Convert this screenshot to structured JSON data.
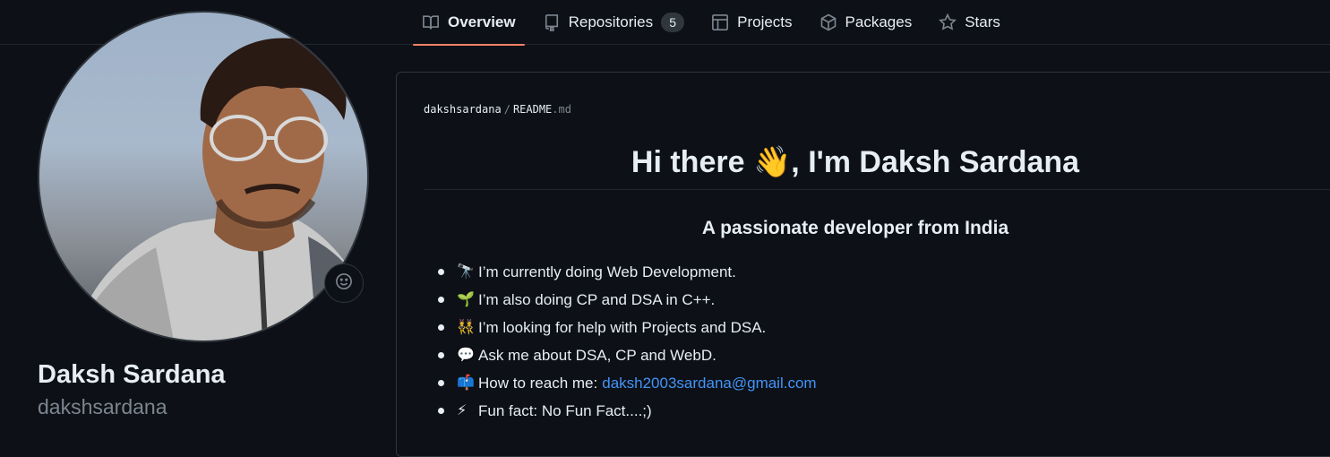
{
  "nav": {
    "tabs": [
      {
        "label": "Overview",
        "icon": "book-icon",
        "selected": true
      },
      {
        "label": "Repositories",
        "icon": "repo-icon",
        "count": "5"
      },
      {
        "label": "Projects",
        "icon": "table-icon"
      },
      {
        "label": "Packages",
        "icon": "package-icon"
      },
      {
        "label": "Stars",
        "icon": "star-icon"
      }
    ]
  },
  "profile": {
    "name": "Daksh Sardana",
    "login": "dakshsardana",
    "status_icon": "smiley-icon"
  },
  "readme": {
    "path_owner": "dakshsardana",
    "path_separator": "/",
    "path_file": "README",
    "path_ext": ".md",
    "heading_pre": "Hi there ",
    "heading_emoji": "👋",
    "heading_post": ", I'm Daksh Sardana",
    "subheading": "A passionate developer from India",
    "items": [
      {
        "emoji": "🔭",
        "text": "I’m currently doing Web Development."
      },
      {
        "emoji": "🌱",
        "text": "I’m also doing CP and DSA in C++."
      },
      {
        "emoji": "👯",
        "text": "I’m looking for help with Projects and DSA."
      },
      {
        "emoji": "💬",
        "text": "Ask me about DSA, CP and WebD."
      },
      {
        "emoji": "📫",
        "text": "How to reach me:",
        "link": "daksh2003sardana@gmail.com"
      },
      {
        "emoji": "⚡",
        "text": "Fun fact: No Fun Fact....;)"
      }
    ]
  },
  "colors": {
    "background": "#0d1117",
    "text": "#e6edf3",
    "muted": "#7d8590",
    "border": "#30363d",
    "link": "#4493f8",
    "tab_underline": "#f78166"
  }
}
